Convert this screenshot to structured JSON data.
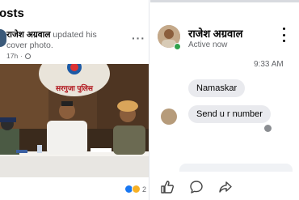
{
  "feed": {
    "section_title": "osts",
    "post": {
      "author": "राजेश अग्रवाल",
      "action": "updated his cover photo.",
      "time": "17h",
      "sign_text": "सरगुजा पुलिस",
      "reaction_count": "2"
    }
  },
  "chat": {
    "contact_name": "राजेश अग्रवाल",
    "status": "Active now",
    "timestamp": "9:33 AM",
    "messages": [
      {
        "text": "Namaskar"
      },
      {
        "text": "Send u r number"
      }
    ],
    "actions": [
      "like-icon",
      "comment-icon",
      "share-icon"
    ]
  },
  "colors": {
    "online": "#31a24c",
    "bubble": "#e9eaee",
    "brand": "#1877f2"
  }
}
